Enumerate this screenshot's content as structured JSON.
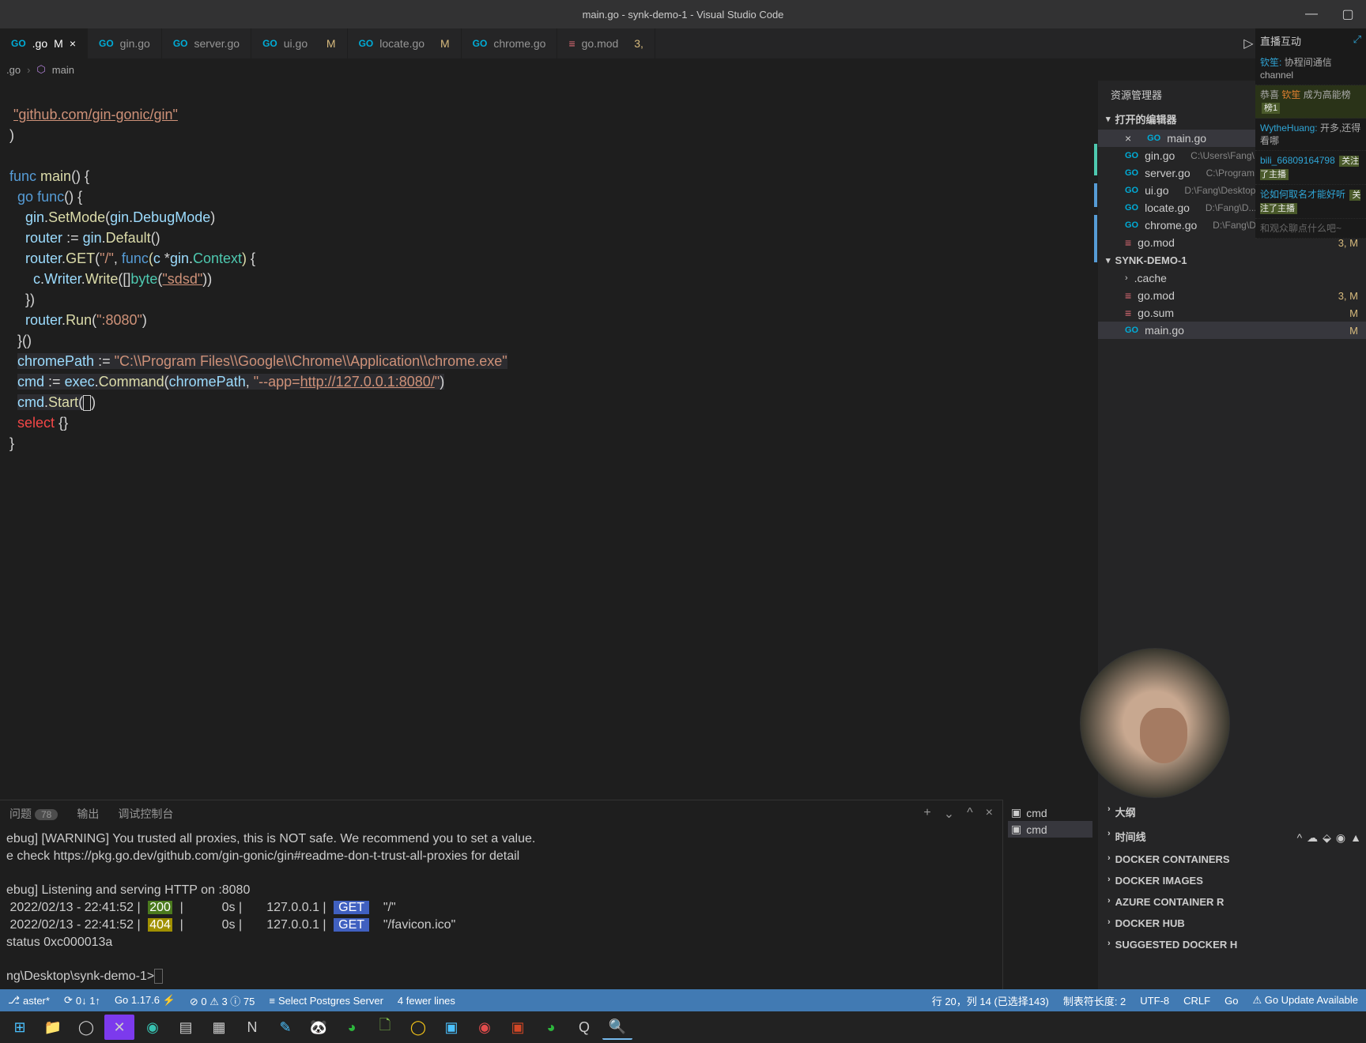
{
  "window": {
    "title": "main.go - synk-demo-1 - Visual Studio Code"
  },
  "tabs": [
    {
      "name": ".go",
      "modified": true,
      "active": true
    },
    {
      "name": "gin.go"
    },
    {
      "name": "server.go"
    },
    {
      "name": "ui.go",
      "modified": true
    },
    {
      "name": "locate.go",
      "modified": true
    },
    {
      "name": "chrome.go"
    },
    {
      "name": "go.mod",
      "suffix": "3,"
    }
  ],
  "breadcrumb": {
    "file": ".go",
    "symbol": "main"
  },
  "code": {
    "import_path": "\"github.com/gin-gonic/gin\"",
    "lines_desc": "Go source defining func main() that starts a gin router goroutine on :8080 with route / returning sdsd, then launches chrome.exe in app mode."
  },
  "code_tokens": {
    "func": "func",
    "main": "main",
    "go": "go",
    "funckey": "func",
    "gin": "gin",
    "SetMode": "SetMode",
    "DebugMode": "DebugMode",
    "router": "router",
    "Default": "Default",
    "GET": "GET",
    "slash": "\"/\"",
    "c": "c",
    "Context": "Context",
    "Writer": "Writer",
    "Write": "Write",
    "byte": "byte",
    "sdsd": "\"sdsd\"",
    "Run": "Run",
    "port": "\":8080\"",
    "chromePath": "chromePath",
    "chromeStr": "\"C:\\\\Program Files\\\\Google\\\\Chrome\\\\Application\\\\chrome.exe\"",
    "cmd": "cmd",
    "exec": "exec",
    "Command": "Command",
    "appflag": "\"--app=http://127.0.0.1:8080/\"",
    "Start": "Start",
    "select": "select"
  },
  "sidebar": {
    "title": "资源管理器",
    "open_editors": "打开的编辑器",
    "items": [
      {
        "name": "main.go",
        "active": true
      },
      {
        "name": "gin.go",
        "path": "C:\\Users\\Fang\\..."
      },
      {
        "name": "server.go",
        "path": "C:\\Program F..."
      },
      {
        "name": "ui.go",
        "path": "D:\\Fang\\Desktop\\lorca"
      },
      {
        "name": "locate.go",
        "path": "D:\\Fang\\D..."
      },
      {
        "name": "chrome.go",
        "path": "D:\\Fang\\Desktop\\..."
      },
      {
        "name": "go.mod",
        "suffix": "3, M"
      }
    ],
    "project": "SYNK-DEMO-1",
    "files": [
      {
        "name": ".cache",
        "folder": true
      },
      {
        "name": "go.mod",
        "suffix": "3, M"
      },
      {
        "name": "go.sum",
        "suffix": "M"
      },
      {
        "name": "main.go",
        "suffix": "M",
        "active": true
      }
    ]
  },
  "panel": {
    "tabs": {
      "problems": "问题",
      "problems_count": "78",
      "output": "输出",
      "debug": "调试控制台"
    },
    "terminal_lines": [
      "ebug] [WARNING] You trusted all proxies, this is NOT safe. We recommend you to set a value.",
      "e check https://pkg.go.dev/github.com/gin-gonic/gin#readme-don-t-trust-all-proxies for detail",
      "",
      "ebug] Listening and serving HTTP on :8080"
    ],
    "log_rows": [
      {
        "ts": " 2022/02/13 - 22:41:52 |",
        "code": "200",
        "mid": "|           0s |       127.0.0.1 |",
        "method": "GET",
        "path": "    \"/\""
      },
      {
        "ts": " 2022/02/13 - 22:41:52 |",
        "code": "404",
        "mid": "|           0s |       127.0.0.1 |",
        "method": "GET",
        "path": "    \"/favicon.ico\""
      }
    ],
    "status_line": "status 0xc000013a",
    "prompt": "ng\\Desktop\\synk-demo-1>",
    "term_side": [
      "cmd",
      "cmd"
    ]
  },
  "outline": {
    "items": [
      "大纲",
      "时间线",
      "DOCKER CONTAINERS",
      "DOCKER IMAGES",
      "AZURE CONTAINER R",
      "DOCKER HUB",
      "SUGGESTED DOCKER H"
    ]
  },
  "status": {
    "branch": "aster*",
    "sync": "0↓ 1↑",
    "go_ver": "Go 1.17.6 ⚡",
    "errs": "⊘ 0 ⚠ 3 ⓘ 75",
    "postgres": "Select Postgres Server",
    "fewer": "4 fewer lines",
    "cursor": "行 20，列 14 (已选择143)",
    "tabsize": "制表符长度: 2",
    "enc": "UTF-8",
    "eol": "CRLF",
    "lang": "Go",
    "update": "⚠ Go Update Available"
  },
  "chat": {
    "title": "直播互动",
    "rows": [
      {
        "name": "钦笙:",
        "text": "协程间通信channel"
      },
      {
        "pre": "恭喜 ",
        "name": "钦笙",
        "text": " 成为高能榜",
        "badge": "榜1"
      },
      {
        "name": "WytheHuang:",
        "text": "开多,还得看哪"
      },
      {
        "name": "bili_66809164798",
        "text": "关注了主播"
      },
      {
        "name": "论如何取名才能好听",
        "text": "关注了主播"
      },
      {
        "text": "和观众聊点什么吧~"
      }
    ]
  },
  "taskbar": {
    "icons": [
      "start",
      "files",
      "obs",
      "x1",
      "edge",
      "file",
      "w1",
      "w2",
      "note",
      "blue",
      "panda",
      "wechat1",
      "leaf",
      "circle",
      "sq1",
      "red",
      "ppt",
      "wechat2",
      "q",
      "search"
    ]
  }
}
